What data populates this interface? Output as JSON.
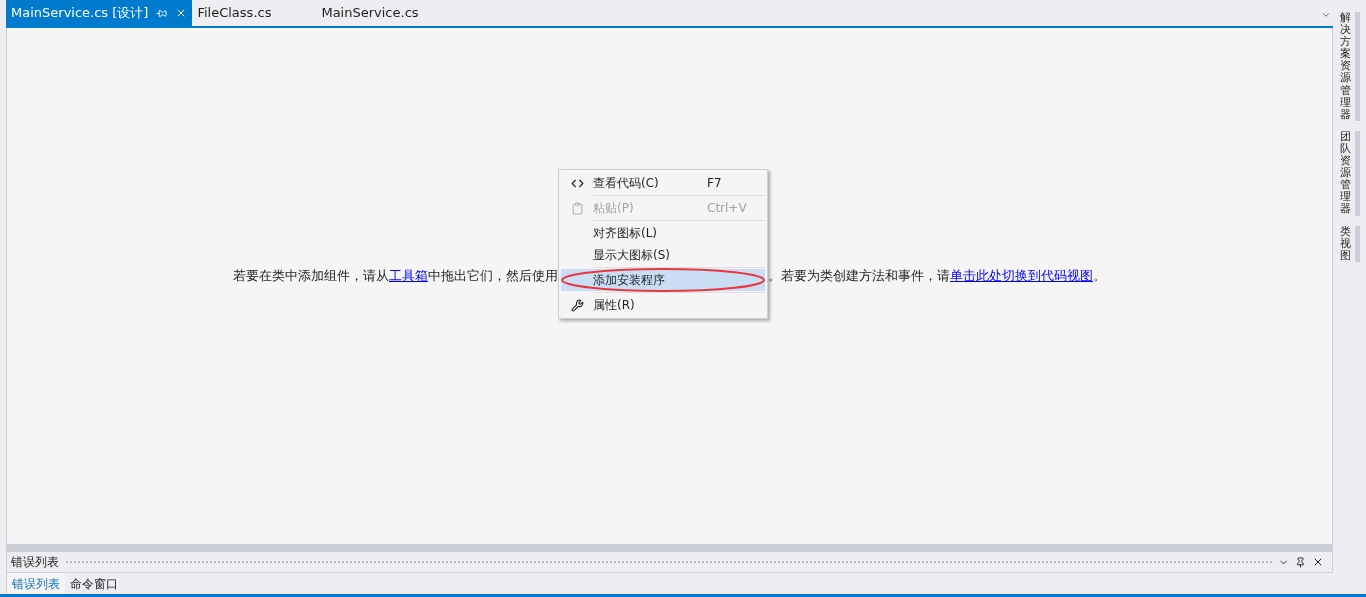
{
  "tabs": [
    {
      "label": "MainService.cs [设计]",
      "selected": true
    },
    {
      "label": "FileClass.cs",
      "selected": false
    },
    {
      "label": "MainService.cs",
      "selected": false
    }
  ],
  "designer": {
    "hint_before": "若要在类中添加组件，请从",
    "link_1": "工具箱",
    "hint_middle": "中拖出它们，然后使用",
    "hint_after": "。若要为类创建方法和事件，请",
    "link_2": "单击此处切换到代码视图",
    "hint_end": "。"
  },
  "context_menu": [
    {
      "kind": "item",
      "label": "查看代码(C)",
      "shortcut": "F7",
      "disabled": false,
      "selected": false
    },
    {
      "kind": "separator"
    },
    {
      "kind": "item",
      "label": "粘贴(P)",
      "shortcut": "Ctrl+V",
      "disabled": true,
      "selected": false
    },
    {
      "kind": "separator"
    },
    {
      "kind": "item",
      "label": "对齐图标(L)",
      "disabled": false,
      "selected": false
    },
    {
      "kind": "item",
      "label": "显示大图标(S)",
      "disabled": false,
      "selected": false
    },
    {
      "kind": "separator"
    },
    {
      "kind": "item",
      "label": "添加安装程序",
      "disabled": false,
      "selected": true
    },
    {
      "kind": "separator"
    },
    {
      "kind": "item",
      "label": "属性(R)",
      "disabled": false,
      "selected": false
    }
  ],
  "side_tabs": [
    "解决方案资源管理器",
    "团队资源管理器",
    "类视图"
  ],
  "bottom_panel": {
    "title": "错误列表",
    "tabs": [
      {
        "label": "错误列表",
        "selected": true
      },
      {
        "label": "命令窗口",
        "selected": false
      }
    ]
  }
}
